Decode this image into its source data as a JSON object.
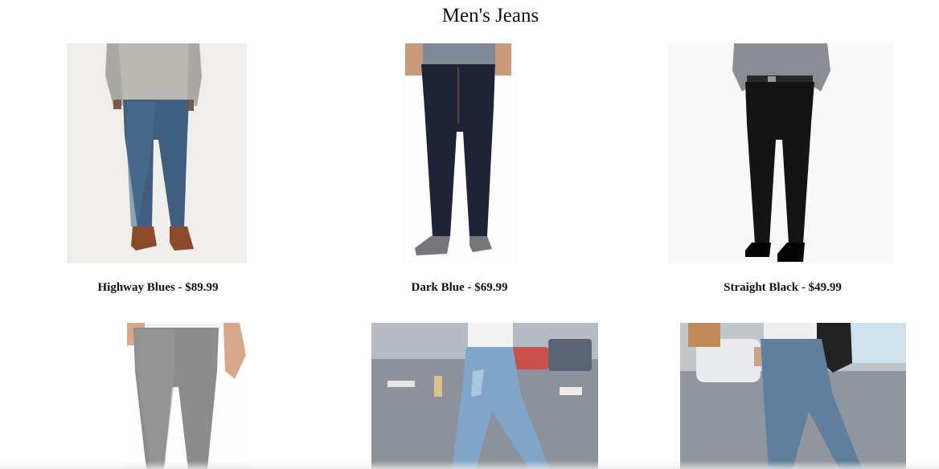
{
  "page": {
    "title": "Men's Jeans"
  },
  "products": [
    {
      "name": "Highway Blues - $89.99",
      "image": "model wearing medium-wash blue jeans, grey sweater, brown shoes"
    },
    {
      "name": "Dark Blue - $69.99",
      "image": "dark indigo jeans with grey shirt and grey sneakers"
    },
    {
      "name": "Straight Black - $49.99",
      "image": "black straight jeans with belt and black shoes"
    },
    {
      "name": "",
      "image": "grey slim jeans with white t-shirt"
    },
    {
      "name": "",
      "image": "light distressed jeans walking on street"
    },
    {
      "name": "",
      "image": "mid-blue jeans with watch and backpack on street"
    }
  ],
  "colors": {
    "jeans_highway": "#3f5f80",
    "jeans_dark": "#1e2436",
    "jeans_black": "#141414",
    "jeans_grey": "#8c8c8c",
    "jeans_light": "#7fa6c8",
    "jeans_mid": "#5f7f9c"
  }
}
